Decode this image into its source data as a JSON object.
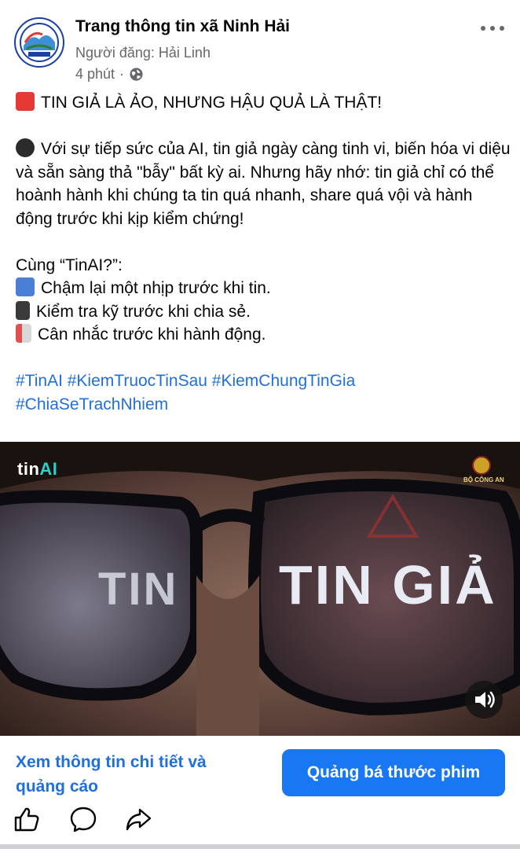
{
  "header": {
    "page_name": "Trang thông tin xã Ninh Hải",
    "poster_line": "Người đăng: Hải Linh",
    "time": "4 phút",
    "separator": "·",
    "audience_icon": "globe-icon",
    "more_icon": "more-options-icon",
    "avatar_label": "XÃ NINH HẢI"
  },
  "post": {
    "headline": "TIN GIẢ LÀ ẢO, NHƯNG HẬU QUẢ LÀ THẬT!",
    "headline_icon": "siren-emoji",
    "body_icon": "bomb-emoji",
    "body": "Với sự tiếp sức của AI, tin giả ngày càng tinh vi, biến hóa vi diệu và sẵn sàng thả \"bẫy\" bất kỳ ai. Nhưng hãy nhớ: tin giả chỉ có thể hoành hành khi chúng ta tin quá nhanh, share quá vội và hành động trước khi kịp kiểm chứng!",
    "list_title": "Cùng “TinAI?”:",
    "list": [
      {
        "icon": "pause-button-emoji",
        "text": "Chậm lại một nhịp trước khi tin."
      },
      {
        "icon": "mobile-arrow-emoji",
        "text": "Kiểm tra kỹ trước khi chia sẻ."
      },
      {
        "icon": "shield-emoji",
        "text": "Cân nhắc trước khi hành động."
      }
    ],
    "hashtags_line1": "#TinAI #KiemTruocTinSau #KiemChungTinGia",
    "hashtags_line2": "#ChiaSeTrachNhiem",
    "hashtag_color": "#216fdb"
  },
  "media": {
    "logo_main": "tin",
    "logo_ai": "AI",
    "badge_text": "BỘ CÔNG AN",
    "lens_left_text": "TIN",
    "lens_right_text": "TIN GIẢ",
    "sound_icon": "speaker-icon"
  },
  "cta": {
    "link_text": "Xem thông tin chi tiết và quảng cáo",
    "button_label": "Quảng bá thước phim",
    "button_color": "#1877f2"
  },
  "actions": {
    "icons": [
      "like-icon",
      "comment-icon",
      "share-icon"
    ]
  }
}
